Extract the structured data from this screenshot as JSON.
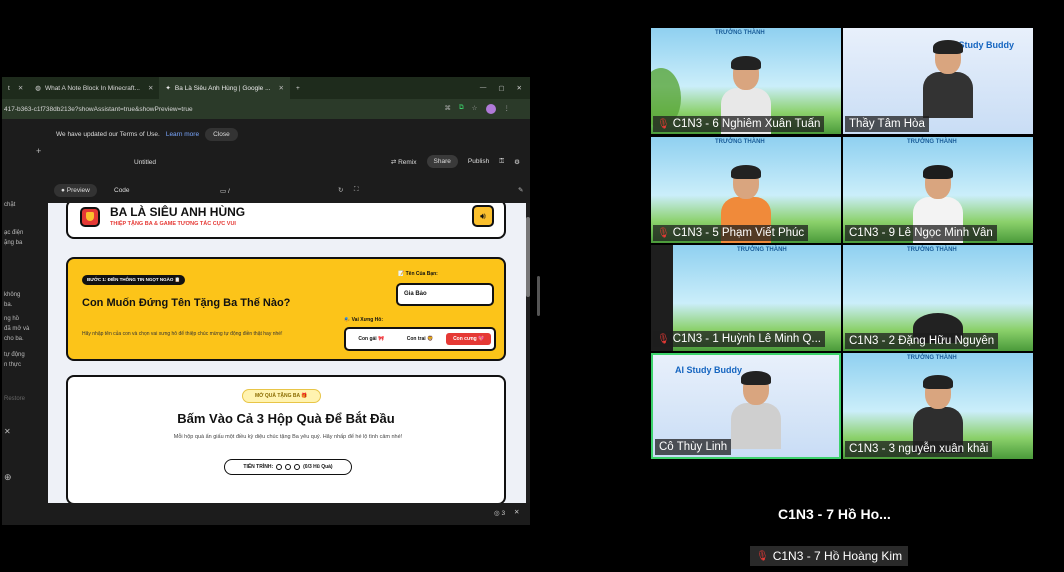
{
  "browser": {
    "tabs": [
      {
        "label": "t",
        "active": false
      },
      {
        "label": "What A Note Block In Minecraft...",
        "active": false
      },
      {
        "label": "Ba Là Siêu Anh Hùng | Google ...",
        "active": true
      }
    ],
    "new_tab": "+",
    "address": "417-b363-c1f738db213e?showAssistant=true&showPreview=true",
    "profile_initial": "K"
  },
  "notice": {
    "text": "We have updated our Terms of Use.",
    "link": "Learn more",
    "close": "Close"
  },
  "app": {
    "title": "Untitled",
    "remix": "Remix",
    "share": "Share",
    "publish": "Publish"
  },
  "left_panel": {
    "lines": [
      "chặt",
      "ạc điện",
      "ặng ba",
      "không",
      "ba.",
      "ng hồ",
      "đã mở và",
      "cho ba.",
      "tự động",
      "n thực",
      "Restore"
    ]
  },
  "view": {
    "preview": "Preview",
    "code": "Code",
    "path": "/"
  },
  "page": {
    "header_title": "BA LÀ SIÊU ANH HÙNG",
    "header_sub": "THIỆP TẶNG BA & GAME TƯƠNG TÁC CỰC VUI",
    "step_badge": "BƯỚC 1: ĐIỀN THÔNG TIN NGỌT NGÀO 📋",
    "form_title": "Con Muốn Đứng Tên Tặng Ba Thế Nào?",
    "form_desc": "Hãy nhập tên của con và chọn vai xưng hô để thiệp chúc mừng tự động điền thật hay nhé!",
    "name_label": "📝 Tên Của Bạn:",
    "name_value": "Gia Bảo",
    "call_label": "🎭 Vai Xưng Hô:",
    "call_options": [
      "Con gái 🎀",
      "Con trai 🦁",
      "Con cưng 💖"
    ],
    "gift_badge": "MỞ QUÀ TẶNG BA 🎁",
    "gift_title": "Bấm Vào Cả 3 Hộp Quà Để Bắt Đầu",
    "gift_desc": "Mỗi hộp quà ẩn giấu một điều kỳ diệu chúc tặng Ba yêu quý. Hãy nhấp để hé lộ tình cảm nhé!",
    "progress_label": "TIẾN TRÌNH:",
    "progress_count": "(0/3 Hũ Quà)"
  },
  "bottom": {
    "count": "3"
  },
  "meeting": {
    "participants": [
      {
        "name": "C1N3 - 6 Nghiêm Xuân Tuấn",
        "muted": true
      },
      {
        "name": "Thầy Tâm Hòa",
        "muted": false
      },
      {
        "name": "C1N3 - 5 Phạm Viết Phúc",
        "muted": true
      },
      {
        "name": "C1N3 - 9 Lê Ngọc Minh Vân",
        "muted": false
      },
      {
        "name": "C1N3 - 1 Huỳnh Lê Minh Q...",
        "muted": true
      },
      {
        "name": "C1N3 - 2 Đặng Hữu Nguyên",
        "muted": false
      },
      {
        "name": "Cô Thùy Linh",
        "muted": false
      },
      {
        "name": "C1N3 - 3 nguyễn xuân khải",
        "muted": false
      }
    ],
    "ai_label": "AI Study Buddy",
    "big_name": "C1N3 - 7 Hồ Ho...",
    "bottom_name": "C1N3 - 7 Hồ Hoàng Kim"
  }
}
